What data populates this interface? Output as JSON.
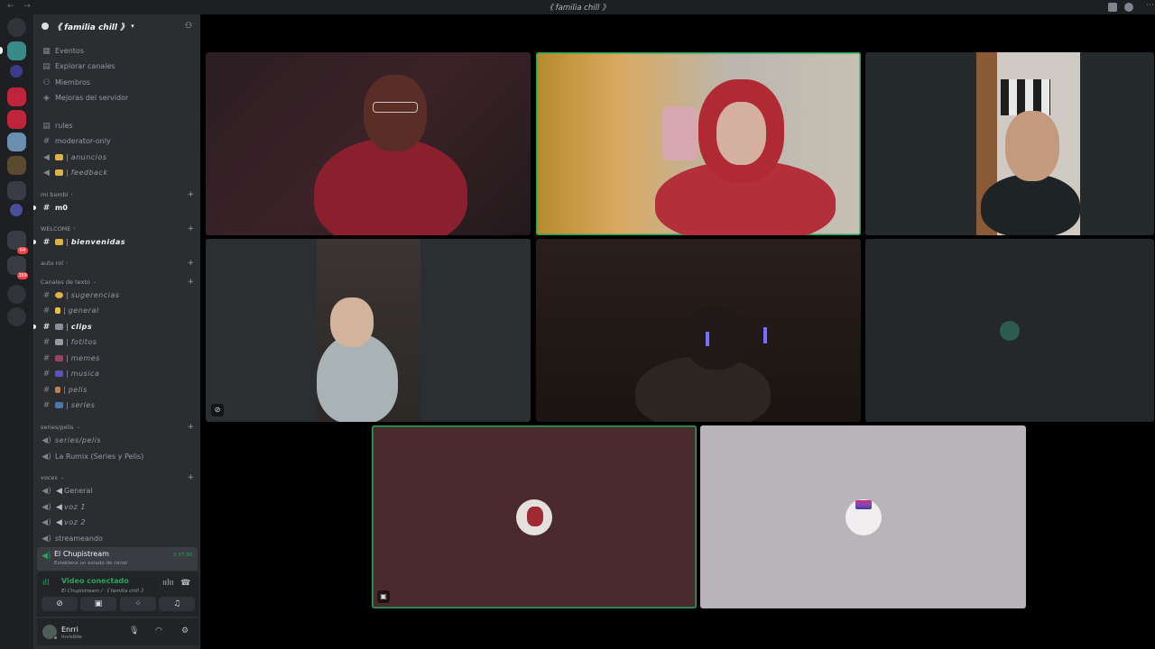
{
  "titlebar": {
    "nav": "← →",
    "title": "《 familia chill 》",
    "more_label": "⋯"
  },
  "server_rail": {
    "badges": [
      "64",
      "389"
    ]
  },
  "guild": {
    "name": "《 familia chill 》",
    "caret": "▾"
  },
  "menu": [
    {
      "icon": "calendar-icon",
      "label": "Eventos"
    },
    {
      "icon": "compass-icon",
      "label": "Explorar canales"
    },
    {
      "icon": "members-icon",
      "label": "Miembros"
    },
    {
      "icon": "boost-icon",
      "label": "Mejoras del servidor"
    }
  ],
  "channels_top": [
    {
      "icon": "rules-icon",
      "label": "rules"
    },
    {
      "icon": "hash-icon",
      "label": "moderator-only"
    },
    {
      "icon": "megaphone-icon",
      "label": "anuncios"
    },
    {
      "icon": "megaphone-icon",
      "label": "feedback"
    }
  ],
  "categories": {
    "mi_bambi": "mi bambi",
    "welcome": "WELCOME",
    "auto_rol": "auto rol",
    "canales": "Canales de texto",
    "series": "series/pelis",
    "voces": "voces"
  },
  "channels_bambi": [
    {
      "label": "m0"
    }
  ],
  "channels_welcome": [
    {
      "label": "bienvenidas"
    }
  ],
  "text_channels": [
    {
      "label": "sugerencias"
    },
    {
      "label": "general"
    },
    {
      "label": "clips"
    },
    {
      "label": "fotitos"
    },
    {
      "label": "memes"
    },
    {
      "label": "musica"
    },
    {
      "label": "pelis"
    },
    {
      "label": "series"
    }
  ],
  "series_channels": [
    {
      "label": "series/pelis"
    },
    {
      "label": "La Rumix (Series y Pelis)"
    }
  ],
  "voice_channels": [
    {
      "label": "General"
    },
    {
      "label": "voz 1"
    },
    {
      "label": "voz 2"
    },
    {
      "label": "streameando"
    }
  ],
  "active_voice": {
    "name": "El Chupistream",
    "status": "Establece un estado de canal",
    "time": "3:37:38"
  },
  "voice_panel": {
    "status": "Video conectado",
    "sub": "El Chupistream / 《 familia chill 》"
  },
  "user": {
    "name": "Enrri",
    "status": "Invisible"
  },
  "colors": {
    "green": "#23a55a",
    "sidebar": "#2b2d31",
    "rail": "#1e1f22",
    "tile_maroon": "#4b2a2d",
    "tile_light": "#b7b4ba"
  }
}
